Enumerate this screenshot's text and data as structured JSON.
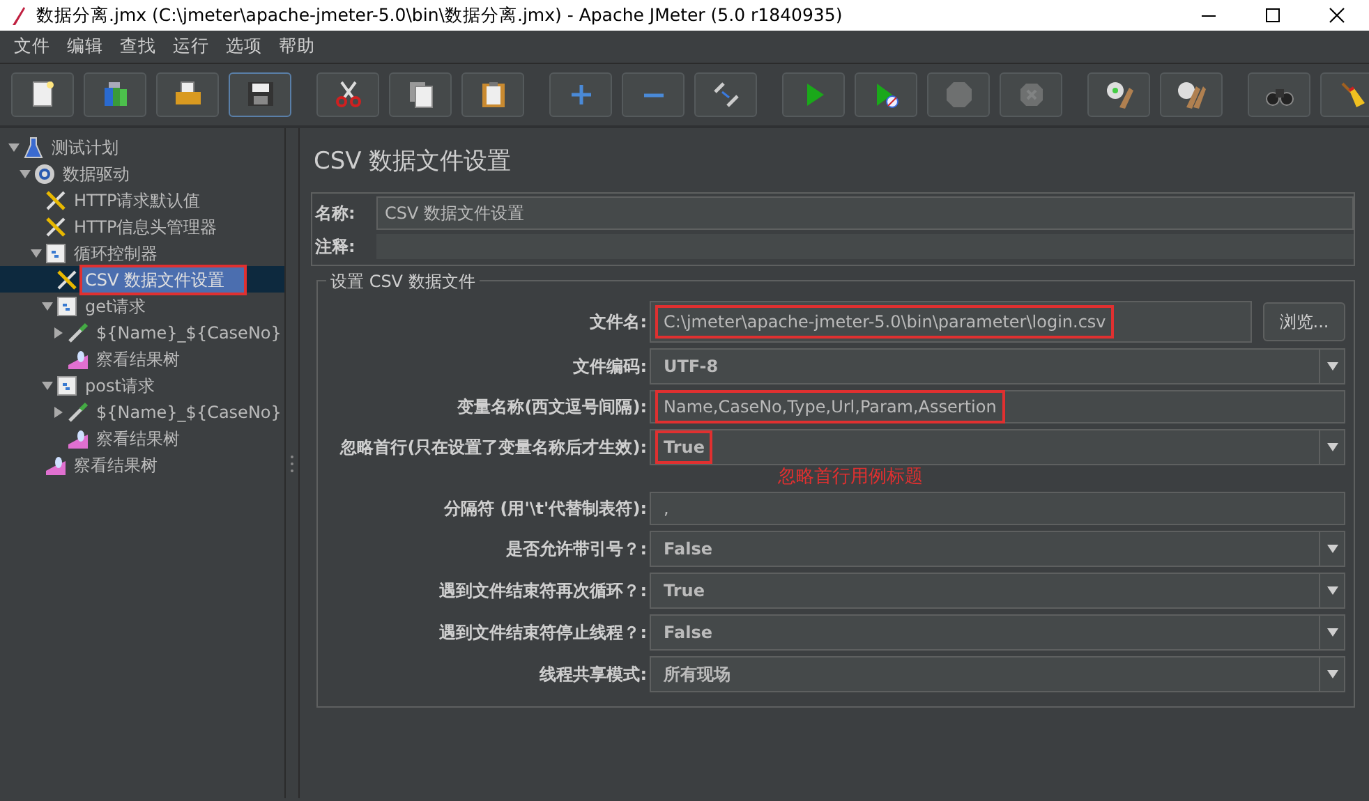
{
  "window": {
    "title": "数据分离.jmx (C:\\jmeter\\apache-jmeter-5.0\\bin\\数据分离.jmx) - Apache JMeter (5.0 r1840935)"
  },
  "menu": [
    "文件",
    "编辑",
    "查找",
    "运行",
    "选项",
    "帮助"
  ],
  "toolbar": [
    [
      {
        "kind": "new",
        "disabled": false,
        "focused": false
      },
      {
        "kind": "templates",
        "disabled": false,
        "focused": false
      },
      {
        "kind": "open",
        "disabled": false,
        "focused": false
      },
      {
        "kind": "save",
        "disabled": false,
        "focused": true
      }
    ],
    [
      {
        "kind": "cut",
        "disabled": false,
        "focused": false
      },
      {
        "kind": "copy",
        "disabled": false,
        "focused": false
      },
      {
        "kind": "paste",
        "disabled": false,
        "focused": false
      }
    ],
    [
      {
        "kind": "expand",
        "disabled": false,
        "focused": false
      },
      {
        "kind": "collapse",
        "disabled": false,
        "focused": false
      },
      {
        "kind": "toggle",
        "disabled": false,
        "focused": false
      }
    ],
    [
      {
        "kind": "start",
        "disabled": false,
        "focused": false
      },
      {
        "kind": "start-no-pause",
        "disabled": false,
        "focused": false
      },
      {
        "kind": "stop",
        "disabled": true,
        "focused": false
      },
      {
        "kind": "shutdown",
        "disabled": true,
        "focused": false
      }
    ],
    [
      {
        "kind": "clear",
        "disabled": false,
        "focused": false
      },
      {
        "kind": "clear-all",
        "disabled": false,
        "focused": false
      }
    ],
    [
      {
        "kind": "search",
        "disabled": false,
        "focused": false
      },
      {
        "kind": "reset",
        "disabled": false,
        "focused": false
      }
    ]
  ],
  "tree": [
    {
      "label": "测试计划",
      "kind": "plan",
      "expanded": true,
      "selected": false,
      "annotated": false,
      "children": [
        {
          "label": "数据驱动",
          "kind": "threads",
          "expanded": true,
          "selected": false,
          "annotated": false,
          "children": [
            {
              "label": "HTTP请求默认值",
              "kind": "config",
              "selected": false,
              "annotated": false
            },
            {
              "label": "HTTP信息头管理器",
              "kind": "config",
              "selected": false,
              "annotated": false
            },
            {
              "label": "循环控制器",
              "kind": "controller",
              "expanded": true,
              "selected": false,
              "annotated": false,
              "children": [
                {
                  "label": "CSV 数据文件设置",
                  "kind": "config",
                  "selected": true,
                  "annotated": true
                },
                {
                  "label": "get请求",
                  "kind": "controller",
                  "expanded": true,
                  "selected": false,
                  "annotated": false,
                  "children": [
                    {
                      "label": "${Name}_${CaseNo}",
                      "kind": "sampler",
                      "expanded": false,
                      "selected": false,
                      "annotated": false
                    },
                    {
                      "label": "察看结果树",
                      "kind": "listener",
                      "selected": false,
                      "annotated": false
                    }
                  ]
                },
                {
                  "label": "post请求",
                  "kind": "controller",
                  "expanded": true,
                  "selected": false,
                  "annotated": false,
                  "children": [
                    {
                      "label": "${Name}_${CaseNo}",
                      "kind": "sampler",
                      "expanded": false,
                      "selected": false,
                      "annotated": false
                    },
                    {
                      "label": "察看结果树",
                      "kind": "listener",
                      "selected": false,
                      "annotated": false
                    }
                  ]
                }
              ]
            },
            {
              "label": "察看结果树",
              "kind": "listener",
              "selected": false,
              "annotated": false
            }
          ]
        }
      ]
    }
  ],
  "panel": {
    "title": "CSV 数据文件设置",
    "name_label": "名称:",
    "name_value": "CSV 数据文件设置",
    "comment_label": "注释:",
    "group_title": "设置 CSV 数据文件",
    "rows": [
      {
        "label": "文件名:",
        "value": "C:\\jmeter\\apache-jmeter-5.0\\bin\\parameter\\login.csv",
        "kind": "file",
        "button": "浏览...",
        "annotated": true
      },
      {
        "label": "文件编码:",
        "value": "UTF-8",
        "kind": "select",
        "annotated": false
      },
      {
        "label": "变量名称(西文逗号间隔):",
        "value": "Name,CaseNo,Type,Url,Param,Assertion",
        "kind": "text",
        "annotated": true
      },
      {
        "label": "忽略首行(只在设置了变量名称后才生效):",
        "value": "True",
        "kind": "select",
        "annotated": true,
        "note": "忽略首行用例标题"
      },
      {
        "label": "分隔符 (用'\\t'代替制表符):",
        "value": ",",
        "kind": "text",
        "annotated": false
      },
      {
        "label": "是否允许带引号？:",
        "value": "False",
        "kind": "select",
        "annotated": false
      },
      {
        "label": "遇到文件结束符再次循环？:",
        "value": "True",
        "kind": "select",
        "annotated": false
      },
      {
        "label": "遇到文件结束符停止线程？:",
        "value": "False",
        "kind": "select",
        "annotated": false
      },
      {
        "label": "线程共享模式:",
        "value": "所有现场",
        "kind": "select",
        "annotated": false
      }
    ]
  }
}
